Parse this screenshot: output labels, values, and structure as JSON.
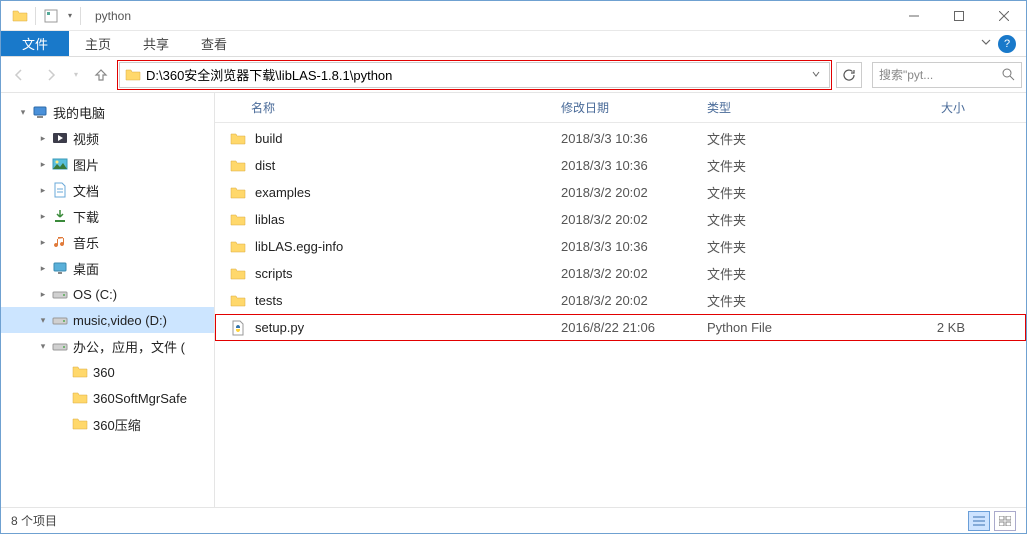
{
  "window": {
    "title": "python"
  },
  "ribbon": {
    "file": "文件",
    "tabs": [
      "主页",
      "共享",
      "查看"
    ]
  },
  "nav": {
    "path": "D:\\360安全浏览器下载\\libLAS-1.8.1\\python",
    "search_placeholder": "搜索\"pyt..."
  },
  "sidebar": {
    "items": [
      {
        "label": "我的电脑",
        "indent": 14,
        "arrow": "▾",
        "icon": "computer"
      },
      {
        "label": "视频",
        "indent": 34,
        "arrow": "▸",
        "icon": "videos"
      },
      {
        "label": "图片",
        "indent": 34,
        "arrow": "▸",
        "icon": "pictures"
      },
      {
        "label": "文档",
        "indent": 34,
        "arrow": "▸",
        "icon": "documents"
      },
      {
        "label": "下载",
        "indent": 34,
        "arrow": "▸",
        "icon": "downloads"
      },
      {
        "label": "音乐",
        "indent": 34,
        "arrow": "▸",
        "icon": "music"
      },
      {
        "label": "桌面",
        "indent": 34,
        "arrow": "▸",
        "icon": "desktop"
      },
      {
        "label": "OS (C:)",
        "indent": 34,
        "arrow": "▸",
        "icon": "drive"
      },
      {
        "label": "music,video (D:)",
        "indent": 34,
        "arrow": "▾",
        "icon": "drive",
        "selected": true
      },
      {
        "label": "办公，应用，文件 (",
        "indent": 34,
        "arrow": "▾",
        "icon": "drive"
      },
      {
        "label": "360",
        "indent": 54,
        "arrow": "",
        "icon": "folder"
      },
      {
        "label": "360SoftMgrSafe",
        "indent": 54,
        "arrow": "",
        "icon": "folder"
      },
      {
        "label": "360压缩",
        "indent": 54,
        "arrow": "",
        "icon": "folder"
      }
    ]
  },
  "filelist": {
    "columns": {
      "name": "名称",
      "date": "修改日期",
      "type": "类型",
      "size": "大小"
    },
    "rows": [
      {
        "name": "build",
        "date": "2018/3/3 10:36",
        "type": "文件夹",
        "size": "",
        "icon": "folder"
      },
      {
        "name": "dist",
        "date": "2018/3/3 10:36",
        "type": "文件夹",
        "size": "",
        "icon": "folder"
      },
      {
        "name": "examples",
        "date": "2018/3/2 20:02",
        "type": "文件夹",
        "size": "",
        "icon": "folder"
      },
      {
        "name": "liblas",
        "date": "2018/3/2 20:02",
        "type": "文件夹",
        "size": "",
        "icon": "folder"
      },
      {
        "name": "libLAS.egg-info",
        "date": "2018/3/3 10:36",
        "type": "文件夹",
        "size": "",
        "icon": "folder"
      },
      {
        "name": "scripts",
        "date": "2018/3/2 20:02",
        "type": "文件夹",
        "size": "",
        "icon": "folder"
      },
      {
        "name": "tests",
        "date": "2018/3/2 20:02",
        "type": "文件夹",
        "size": "",
        "icon": "folder"
      },
      {
        "name": "setup.py",
        "date": "2016/8/22 21:06",
        "type": "Python File",
        "size": "2 KB",
        "icon": "python",
        "highlighted": true
      }
    ]
  },
  "statusbar": {
    "count": "8 个项目"
  }
}
